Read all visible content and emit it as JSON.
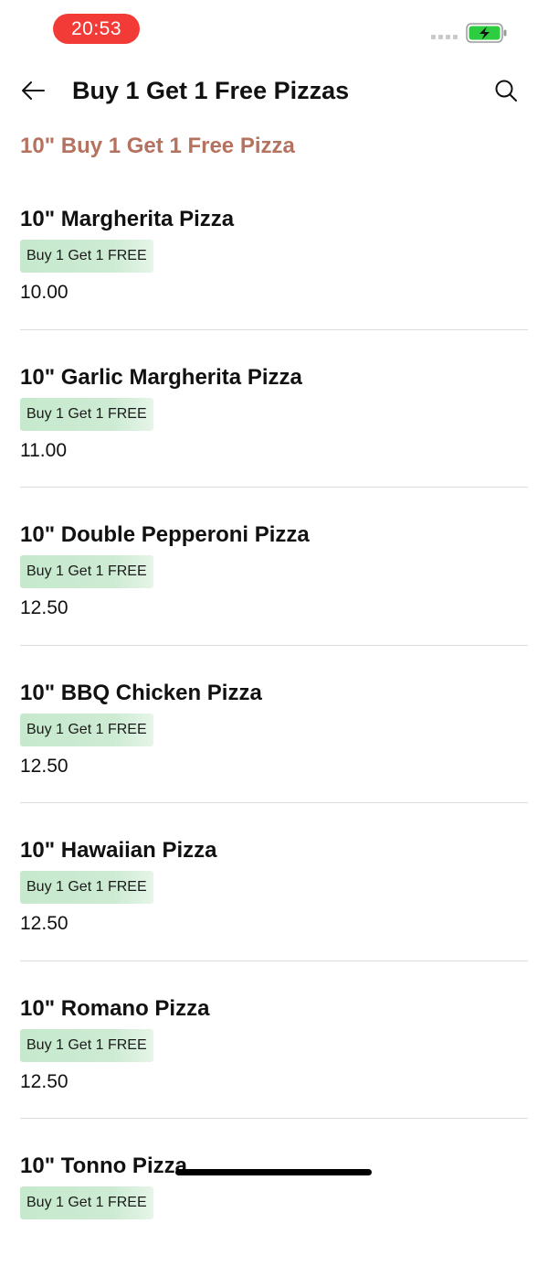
{
  "status_bar": {
    "time": "20:53",
    "battery_color": "#2ecc40",
    "time_pill_color": "#f23b36"
  },
  "header": {
    "title": "Buy 1 Get 1 Free Pizzas",
    "back_icon": "arrow-left-icon",
    "search_icon": "search-icon"
  },
  "section": {
    "title": "10\" Buy 1 Get 1 Free Pizza",
    "color": "#b5725f"
  },
  "items": [
    {
      "name": "10\" Margherita Pizza",
      "badge": "Buy 1 Get 1 FREE",
      "price": "10.00"
    },
    {
      "name": "10\" Garlic Margherita Pizza",
      "badge": "Buy 1 Get 1 FREE",
      "price": "11.00"
    },
    {
      "name": "10\" Double Pepperoni Pizza",
      "badge": "Buy 1 Get 1 FREE",
      "price": "12.50"
    },
    {
      "name": "10\" BBQ Chicken Pizza",
      "badge": "Buy 1 Get 1 FREE",
      "price": "12.50"
    },
    {
      "name": "10\" Hawaiian Pizza",
      "badge": "Buy 1 Get 1 FREE",
      "price": "12.50"
    },
    {
      "name": "10\" Romano Pizza",
      "badge": "Buy 1 Get 1 FREE",
      "price": "12.50"
    },
    {
      "name": "10\" Tonno Pizza",
      "badge": "Buy 1 Get 1 FREE",
      "price": ""
    }
  ]
}
